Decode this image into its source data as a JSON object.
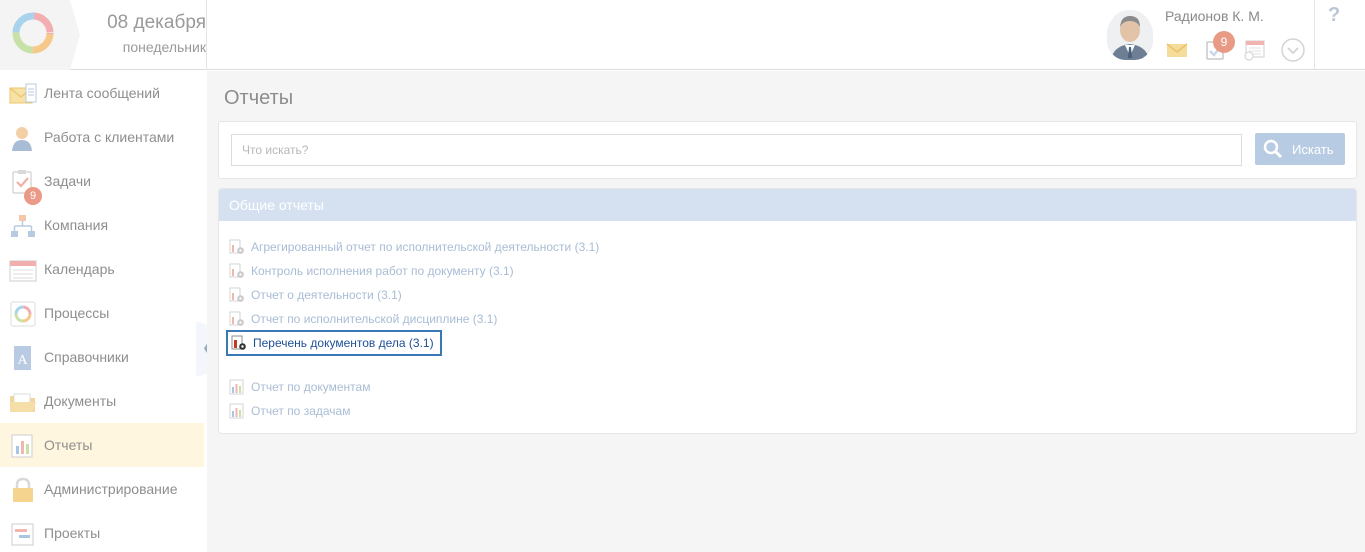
{
  "header": {
    "date": "08 декабря",
    "weekday": "понедельник",
    "user_name": "Радионов К. М.",
    "tasks_badge": "9",
    "help": "?"
  },
  "sidebar": {
    "items": [
      {
        "label": "Лента сообщений",
        "icon": "mail-feed-icon"
      },
      {
        "label": "Работа с клиентами",
        "icon": "clients-icon"
      },
      {
        "label": "Задачи",
        "icon": "tasks-icon",
        "badge": "9"
      },
      {
        "label": "Компания",
        "icon": "company-icon"
      },
      {
        "label": "Календарь",
        "icon": "calendar-icon"
      },
      {
        "label": "Процессы",
        "icon": "processes-icon"
      },
      {
        "label": "Справочники",
        "icon": "directories-icon"
      },
      {
        "label": "Документы",
        "icon": "folder-icon"
      },
      {
        "label": "Отчеты",
        "icon": "reports-icon",
        "active": true
      },
      {
        "label": "Администрирование",
        "icon": "lock-icon"
      },
      {
        "label": "Проекты",
        "icon": "projects-icon"
      }
    ]
  },
  "main": {
    "title": "Отчеты",
    "search": {
      "placeholder": "Что искать?",
      "button_label": "Искать"
    },
    "reports_section": {
      "title": "Общие отчеты",
      "items": [
        {
          "label": "Агрегированный отчет по исполнительской деятельности (3.1)",
          "icon": "report-gear-icon"
        },
        {
          "label": "Контроль исполнения работ по документу (3.1)",
          "icon": "report-gear-icon"
        },
        {
          "label": "Отчет о деятельности (3.1)",
          "icon": "report-gear-icon"
        },
        {
          "label": "Отчет по исполнительской дисциплине (3.1)",
          "icon": "report-gear-icon"
        },
        {
          "label": "Перечень документов дела (3.1)",
          "icon": "report-gear-icon",
          "highlighted": true
        },
        {
          "label": "Отчет по документам",
          "icon": "report-chart-icon"
        },
        {
          "label": "Отчет по задачам",
          "icon": "report-chart-icon"
        }
      ]
    }
  },
  "colors": {
    "highlight_border": "#3a77b7",
    "link": "#a9bcd5",
    "active_nav_bg": "#fff6df",
    "section_header_bg": "#d5e1f1",
    "badge": "#ea9a86"
  }
}
